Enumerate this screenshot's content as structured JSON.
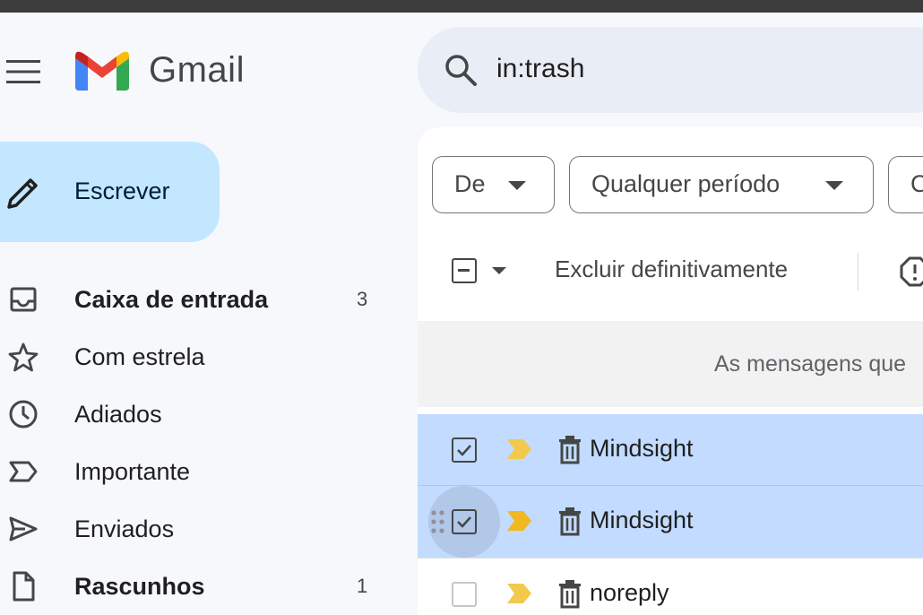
{
  "app": {
    "name": "Gmail"
  },
  "search": {
    "query": "in:trash"
  },
  "compose": {
    "label": "Escrever"
  },
  "sidebar": {
    "items": [
      {
        "label": "Caixa de entrada",
        "count": "3",
        "bold": true,
        "icon": "inbox-icon"
      },
      {
        "label": "Com estrela",
        "count": "",
        "bold": false,
        "icon": "star-icon"
      },
      {
        "label": "Adiados",
        "count": "",
        "bold": false,
        "icon": "clock-icon"
      },
      {
        "label": "Importante",
        "count": "",
        "bold": false,
        "icon": "important-icon"
      },
      {
        "label": "Enviados",
        "count": "",
        "bold": false,
        "icon": "send-icon"
      },
      {
        "label": "Rascunhos",
        "count": "1",
        "bold": true,
        "icon": "draft-icon"
      }
    ]
  },
  "filters": {
    "from_label": "De",
    "period_label": "Qualquer período",
    "third_label": "C"
  },
  "toolbar": {
    "delete_forever_label": "Excluir definitivamente"
  },
  "banner": {
    "text": "As mensagens que"
  },
  "messages": [
    {
      "sender": "Mindsight",
      "checked": true,
      "selected": true
    },
    {
      "sender": "Mindsight",
      "checked": true,
      "selected": true
    },
    {
      "sender": "noreply",
      "checked": false,
      "selected": false
    }
  ],
  "colors": {
    "compose_bg": "#c2e7ff",
    "search_bg": "#e9eef6",
    "selected_row": "#c2dbff",
    "important_marker": "#f2c94c"
  }
}
